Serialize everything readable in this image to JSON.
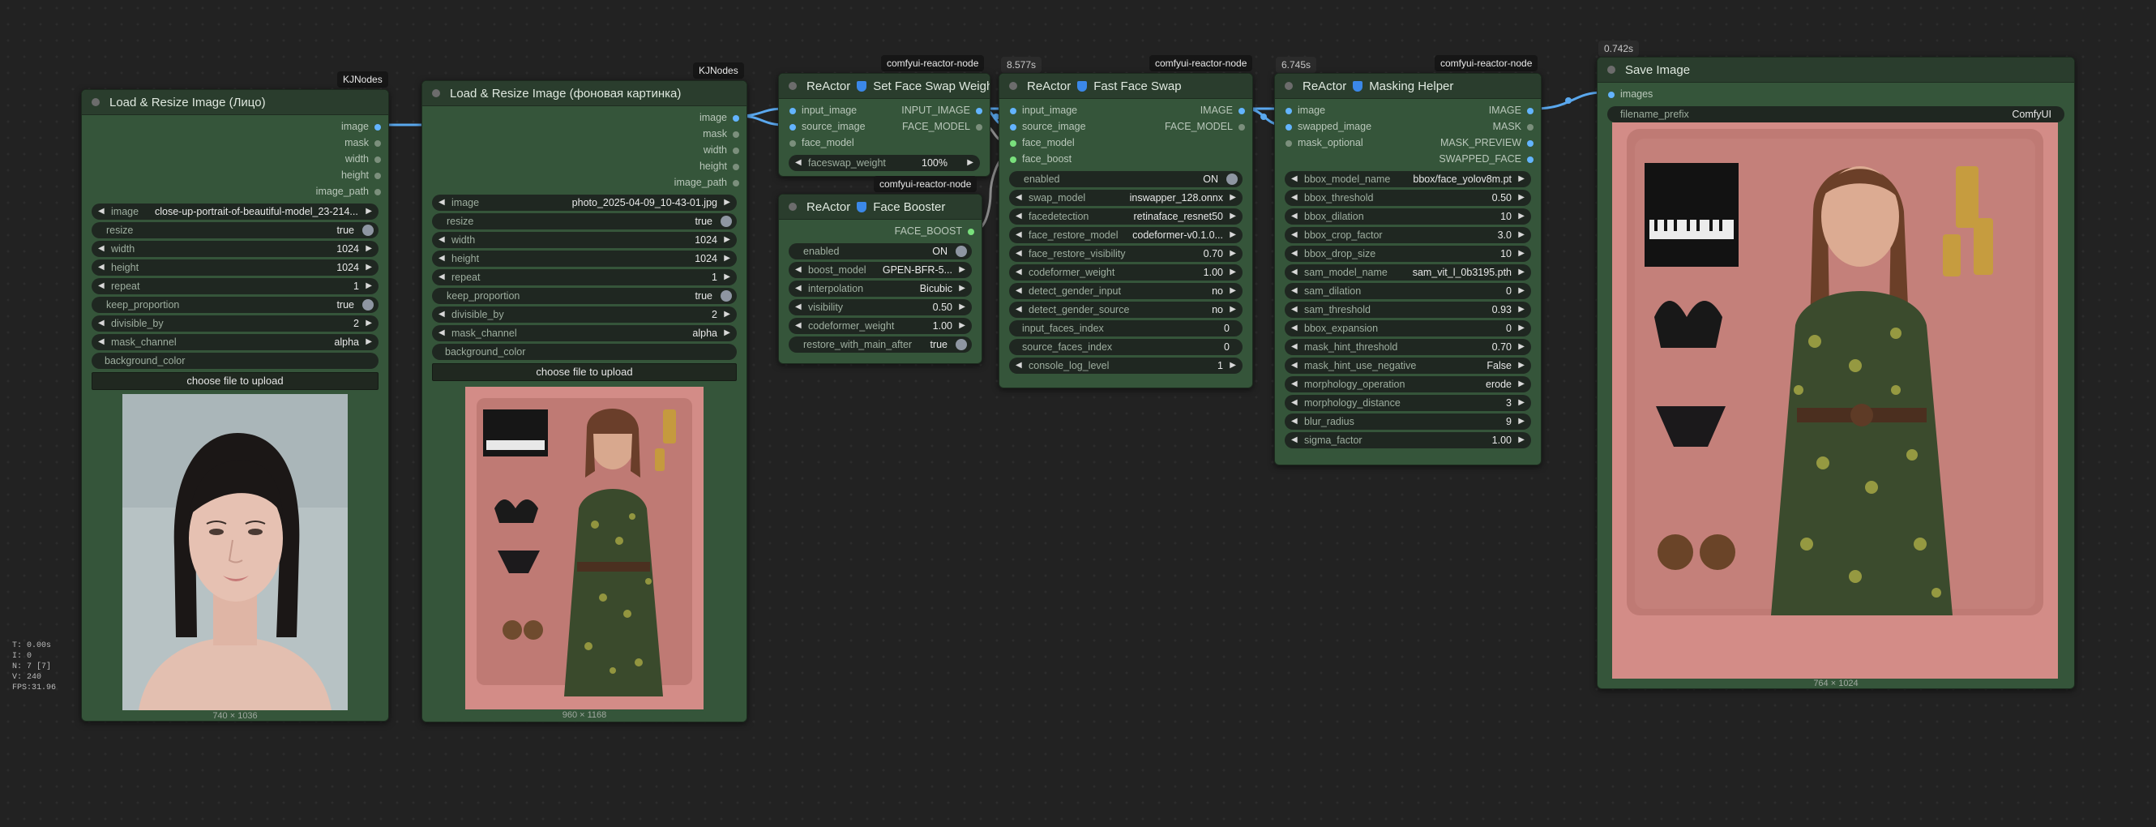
{
  "stats": {
    "t": "T: 0.00s",
    "i": "I: 0",
    "n": "N: 7 [7]",
    "v": "V: 240",
    "fps": "FPS:31.96"
  },
  "colors": {
    "canvas": "#222222",
    "node_body": "#35553a",
    "node_title": "#2a3d2d",
    "link_blue": "#5aa8ee",
    "link_grey": "#9a9a9a"
  },
  "nodes": {
    "face": {
      "badge": "KJNodes",
      "title": "Load & Resize Image (Лицо)",
      "outputs": [
        "image",
        "mask",
        "width",
        "height",
        "image_path"
      ],
      "widgets": [
        {
          "label": "image",
          "value": "close-up-portrait-of-beautiful-model_23-214..."
        },
        {
          "label": "resize",
          "value": "true"
        },
        {
          "label": "width",
          "value": "1024"
        },
        {
          "label": "height",
          "value": "1024"
        },
        {
          "label": "repeat",
          "value": "1"
        },
        {
          "label": "keep_proportion",
          "value": "true"
        },
        {
          "label": "divisible_by",
          "value": "2"
        },
        {
          "label": "mask_channel",
          "value": "alpha"
        },
        {
          "label": "background_color",
          "value": ""
        }
      ],
      "button": "choose file to upload",
      "dims": "740 × 1036"
    },
    "bg": {
      "badge": "KJNodes",
      "title": "Load & Resize Image (фоновая картинка)",
      "outputs": [
        "image",
        "mask",
        "width",
        "height",
        "image_path"
      ],
      "widgets": [
        {
          "label": "image",
          "value": "photo_2025-04-09_10-43-01.jpg"
        },
        {
          "label": "resize",
          "value": "true"
        },
        {
          "label": "width",
          "value": "1024"
        },
        {
          "label": "height",
          "value": "1024"
        },
        {
          "label": "repeat",
          "value": "1"
        },
        {
          "label": "keep_proportion",
          "value": "true"
        },
        {
          "label": "divisible_by",
          "value": "2"
        },
        {
          "label": "mask_channel",
          "value": "alpha"
        },
        {
          "label": "background_color",
          "value": ""
        }
      ],
      "button": "choose file to upload",
      "dims": "960 × 1168"
    },
    "weight": {
      "badge": "comfyui-reactor-node",
      "title_prefix": "ReActor",
      "title": "Set Face Swap Weight",
      "inputs": [
        "input_image",
        "source_image",
        "face_model"
      ],
      "outputs": [
        "INPUT_IMAGE",
        "FACE_MODEL"
      ],
      "widgets": [
        {
          "label": "faceswap_weight",
          "value": "100%"
        }
      ]
    },
    "booster": {
      "badge": "comfyui-reactor-node",
      "title_prefix": "ReActor",
      "title": "Face Booster",
      "outputs": [
        "FACE_BOOST"
      ],
      "widgets": [
        {
          "label": "enabled",
          "value": "ON"
        },
        {
          "label": "boost_model",
          "value": "GPEN-BFR-5..."
        },
        {
          "label": "interpolation",
          "value": "Bicubic"
        },
        {
          "label": "visibility",
          "value": "0.50"
        },
        {
          "label": "codeformer_weight",
          "value": "1.00"
        },
        {
          "label": "restore_with_main_after",
          "value": "true"
        }
      ]
    },
    "swap": {
      "time": "8.577s",
      "badge": "comfyui-reactor-node",
      "title_prefix": "ReActor",
      "title": "Fast Face Swap",
      "inputs": [
        "input_image",
        "source_image",
        "face_model",
        "face_boost"
      ],
      "outputs": [
        "IMAGE",
        "FACE_MODEL"
      ],
      "widgets": [
        {
          "label": "enabled",
          "value": "ON"
        },
        {
          "label": "swap_model",
          "value": "inswapper_128.onnx"
        },
        {
          "label": "facedetection",
          "value": "retinaface_resnet50"
        },
        {
          "label": "face_restore_model",
          "value": "codeformer-v0.1.0..."
        },
        {
          "label": "face_restore_visibility",
          "value": "0.70"
        },
        {
          "label": "codeformer_weight",
          "value": "1.00"
        },
        {
          "label": "detect_gender_input",
          "value": "no"
        },
        {
          "label": "detect_gender_source",
          "value": "no"
        },
        {
          "label": "input_faces_index",
          "value": "0"
        },
        {
          "label": "source_faces_index",
          "value": "0"
        },
        {
          "label": "console_log_level",
          "value": "1"
        }
      ]
    },
    "mask": {
      "time": "6.745s",
      "badge": "comfyui-reactor-node",
      "title_prefix": "ReActor",
      "title": "Masking Helper",
      "inputs": [
        "image",
        "swapped_image",
        "mask_optional"
      ],
      "outputs": [
        "IMAGE",
        "MASK",
        "MASK_PREVIEW",
        "SWAPPED_FACE"
      ],
      "widgets": [
        {
          "label": "bbox_model_name",
          "value": "bbox/face_yolov8m.pt"
        },
        {
          "label": "bbox_threshold",
          "value": "0.50"
        },
        {
          "label": "bbox_dilation",
          "value": "10"
        },
        {
          "label": "bbox_crop_factor",
          "value": "3.0"
        },
        {
          "label": "bbox_drop_size",
          "value": "10"
        },
        {
          "label": "sam_model_name",
          "value": "sam_vit_l_0b3195.pth"
        },
        {
          "label": "sam_dilation",
          "value": "0"
        },
        {
          "label": "sam_threshold",
          "value": "0.93"
        },
        {
          "label": "bbox_expansion",
          "value": "0"
        },
        {
          "label": "mask_hint_threshold",
          "value": "0.70"
        },
        {
          "label": "mask_hint_use_negative",
          "value": "False"
        },
        {
          "label": "morphology_operation",
          "value": "erode"
        },
        {
          "label": "morphology_distance",
          "value": "3"
        },
        {
          "label": "blur_radius",
          "value": "9"
        },
        {
          "label": "sigma_factor",
          "value": "1.00"
        }
      ]
    },
    "save": {
      "time": "0.742s",
      "title": "Save Image",
      "inputs": [
        "images"
      ],
      "widgets": [
        {
          "label": "filename_prefix",
          "value": "ComfyUI"
        }
      ],
      "dims": "764 × 1024"
    }
  }
}
